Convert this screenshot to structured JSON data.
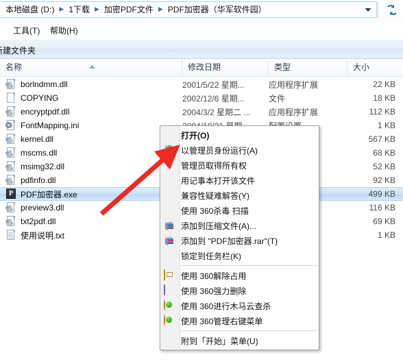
{
  "window": {
    "title": "PDF加密器（华军软件园）"
  },
  "address_bar": {
    "breadcrumbs": [
      "本地磁盘 (D:)",
      "1下载",
      "加密PDF文件",
      "PDF加密器（华军软件园）"
    ],
    "dropdown_icon": "chevron-down-icon",
    "refresh_icon": "refresh-icon"
  },
  "menubar": {
    "items": [
      {
        "label": "工具(T)"
      },
      {
        "label": "帮助(H)"
      }
    ]
  },
  "toolbar": {
    "new_folder_label": "新建文件夹"
  },
  "columns": [
    {
      "key": "name",
      "label": "名称",
      "sorted": true,
      "sort_dir": "asc"
    },
    {
      "key": "date",
      "label": "修改日期",
      "sorted": false
    },
    {
      "key": "type",
      "label": "类型",
      "sorted": false
    },
    {
      "key": "size",
      "label": "大小",
      "sorted": false
    }
  ],
  "files": [
    {
      "name": "borlndmm.dll",
      "icon": "dll-file-icon",
      "date": "2001/5/22 星期...",
      "type": "应用程序扩展",
      "size": "22 KB",
      "selected": false
    },
    {
      "name": "COPYING",
      "icon": "blank-file-icon",
      "date": "2002/12/6 星期...",
      "type": "文件",
      "size": "18 KB",
      "selected": false
    },
    {
      "name": "encryptpdf.dll",
      "icon": "dll-file-icon",
      "date": "2004/3/2 星期二 ...",
      "type": "应用程序扩展",
      "size": "112 KB",
      "selected": false
    },
    {
      "name": "FontMapping.ini",
      "icon": "ini-file-icon",
      "date": "2004/10/21 星期...",
      "type": "配置设置",
      "size": "1 KB",
      "selected": false
    },
    {
      "name": "kernel.dll",
      "icon": "dll-file-icon",
      "date": "",
      "type": "",
      "size": "567 KB",
      "selected": false
    },
    {
      "name": "mscms.dll",
      "icon": "dll-file-icon",
      "date": "",
      "type": "",
      "size": "68 KB",
      "selected": false
    },
    {
      "name": "msimg32.dll",
      "icon": "dll-file-icon",
      "date": "",
      "type": "",
      "size": "52 KB",
      "selected": false
    },
    {
      "name": "pdfinfo.dll",
      "icon": "dll-file-icon",
      "date": "",
      "type": "",
      "size": "92 KB",
      "selected": false
    },
    {
      "name": "PDF加密器.exe",
      "icon": "exe-file-icon",
      "date": "",
      "type": "",
      "size": "499 KB",
      "selected": true
    },
    {
      "name": "preview3.dll",
      "icon": "dll-file-icon",
      "date": "",
      "type": "",
      "size": "116 KB",
      "selected": false
    },
    {
      "name": "txt2pdf.dll",
      "icon": "dll-file-icon",
      "date": "",
      "type": "",
      "size": "69 KB",
      "selected": false
    },
    {
      "name": "使用说明.txt",
      "icon": "txt-file-icon",
      "date": "",
      "type": "",
      "size": "1 KB",
      "selected": false
    }
  ],
  "context_menu": {
    "items": [
      {
        "label": "打开(O)",
        "bold": true,
        "icon": "",
        "separator_after": false
      },
      {
        "label": "以管理员身份运行(A)",
        "bold": false,
        "icon": "uac-shield-icon",
        "separator_after": false
      },
      {
        "label": "管理员取得所有权",
        "bold": false,
        "icon": "",
        "separator_after": false
      },
      {
        "label": "用记事本打开该文件",
        "bold": false,
        "icon": "",
        "separator_after": false
      },
      {
        "label": "兼容性疑难解答(Y)",
        "bold": false,
        "icon": "",
        "separator_after": false
      },
      {
        "label": "使用 360杀毒 扫描",
        "bold": false,
        "icon": "360-shield-icon",
        "separator_after": false
      },
      {
        "label": "添加到压缩文件(A)...",
        "bold": false,
        "icon": "winrar-icon",
        "separator_after": false
      },
      {
        "label": "添加到 \"PDF加密器.rar\"(T)",
        "bold": false,
        "icon": "winrar-icon",
        "separator_after": false
      },
      {
        "label": "锁定到任务栏(K)",
        "bold": false,
        "icon": "",
        "separator_after": true
      },
      {
        "label": "使用 360解除占用",
        "bold": false,
        "icon": "360-unlock-icon",
        "separator_after": false
      },
      {
        "label": "使用 360强力删除",
        "bold": false,
        "icon": "360-shred-icon",
        "separator_after": false
      },
      {
        "label": "使用 360进行木马云查杀",
        "bold": false,
        "icon": "360-ball-icon",
        "separator_after": false
      },
      {
        "label": "使用 360管理右键菜单",
        "bold": false,
        "icon": "360-ball-icon",
        "separator_after": true
      },
      {
        "label": "附到「开始」菜单(U)",
        "bold": false,
        "icon": "",
        "separator_after": false
      }
    ]
  },
  "annotation": {
    "arrow_color": "#ef2a24",
    "points_to": "打开(O)"
  },
  "colors": {
    "selection": "#cde4fa",
    "toolbar_bg": "#e4edf7",
    "menu_bg": "#ffffff",
    "gutter_bg": "#f1f1f1"
  }
}
